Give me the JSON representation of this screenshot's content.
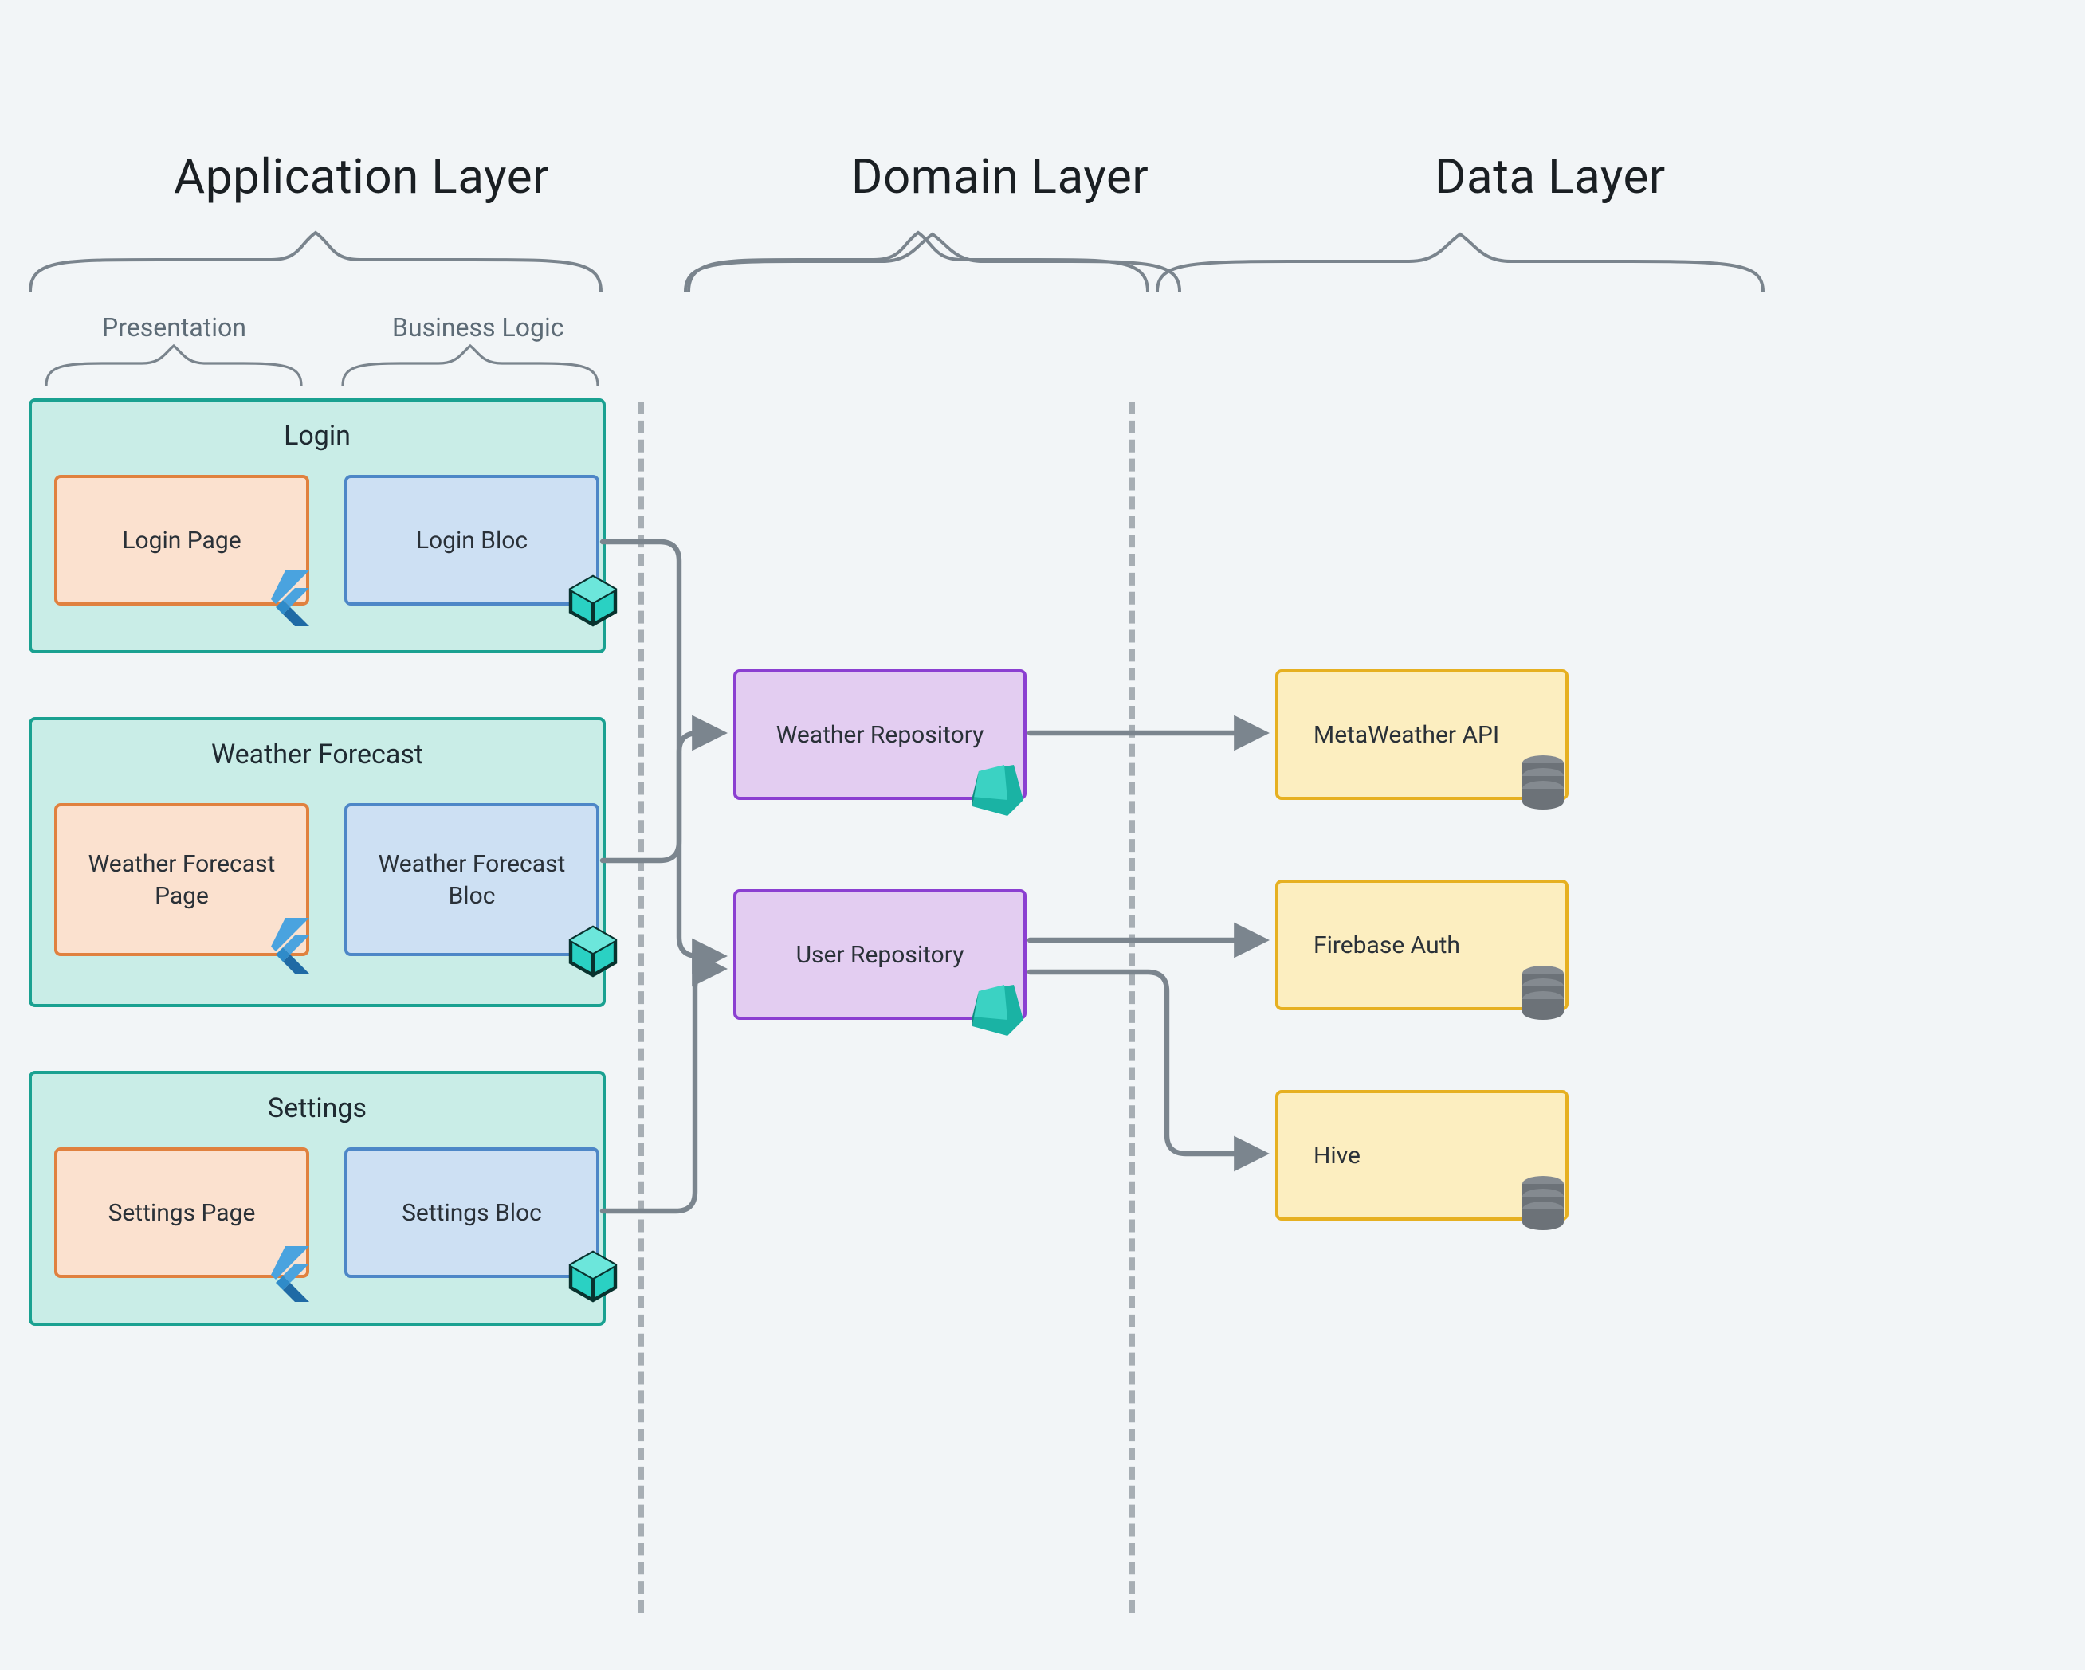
{
  "layers": {
    "application": {
      "title": "Application Layer",
      "sub_presentation": "Presentation",
      "sub_business_logic": "Business Logic"
    },
    "domain": {
      "title": "Domain Layer"
    },
    "data": {
      "title": "Data Layer"
    }
  },
  "features": {
    "login": {
      "title": "Login",
      "page_label": "Login Page",
      "bloc_label": "Login Bloc"
    },
    "weather": {
      "title": "Weather Forecast",
      "page_label": "Weather Forecast Page",
      "bloc_label": "Weather Forecast Bloc"
    },
    "settings": {
      "title": "Settings",
      "page_label": "Settings Page",
      "bloc_label": "Settings Bloc"
    }
  },
  "repositories": {
    "weather": {
      "label": "Weather Repository"
    },
    "user": {
      "label": "User Repository"
    }
  },
  "datasources": {
    "metaweather": {
      "label": "MetaWeather API"
    },
    "firebase_auth": {
      "label": "Firebase Auth"
    },
    "hive": {
      "label": "Hive"
    }
  },
  "connections": [
    {
      "from": "login.bloc",
      "to": "user.repo"
    },
    {
      "from": "weather.bloc",
      "to": "weather.repo"
    },
    {
      "from": "weather.bloc",
      "to": "user.repo"
    },
    {
      "from": "settings.bloc",
      "to": "user.repo"
    },
    {
      "from": "weather.repo",
      "to": "metaweather"
    },
    {
      "from": "user.repo",
      "to": "firebase_auth"
    },
    {
      "from": "user.repo",
      "to": "hive"
    }
  ],
  "icons": {
    "flutter": "flutter-logo-icon",
    "cube": "cube-icon",
    "dart": "dart-logo-icon",
    "db": "database-icon"
  },
  "colors": {
    "background": "#f2f5f7",
    "feature_fill": "#c9ede7",
    "feature_stroke": "#1aa191",
    "page_fill": "#fbe1cf",
    "page_stroke": "#e0813f",
    "bloc_fill": "#cde0f3",
    "bloc_stroke": "#4d87c7",
    "repo_fill": "#e3cdf1",
    "repo_stroke": "#8b3fd1",
    "data_fill": "#fceec0",
    "data_stroke": "#e6b021",
    "arrow": "#7b858e",
    "divider": "#9aa1a8"
  }
}
